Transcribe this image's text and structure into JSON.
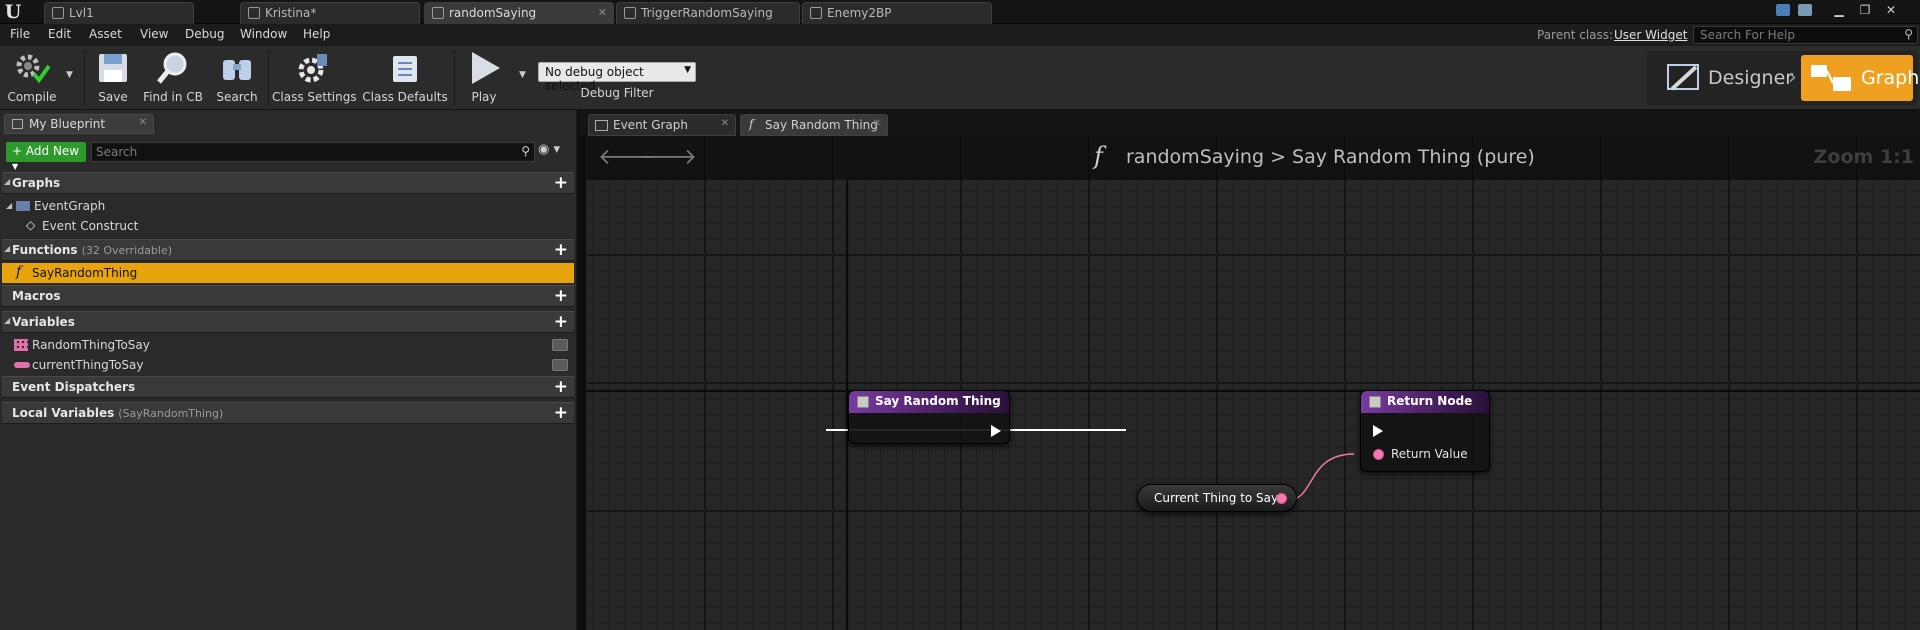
{
  "titlebar": {
    "tabs": [
      {
        "label": "Lvl1"
      },
      {
        "label": "Kristina*"
      },
      {
        "label": "randomSaying"
      },
      {
        "label": "TriggerRandomSaying"
      },
      {
        "label": "Enemy2BP"
      }
    ]
  },
  "menu": {
    "items": [
      "File",
      "Edit",
      "Asset",
      "View",
      "Debug",
      "Window",
      "Help"
    ],
    "parent_class_label": "Parent class:",
    "parent_class_value": "User Widget",
    "help_search_placeholder": "Search For Help"
  },
  "toolbar": {
    "compile": "Compile",
    "save": "Save",
    "find_in_cb": "Find in CB",
    "search": "Search",
    "class_settings": "Class Settings",
    "class_defaults": "Class Defaults",
    "play": "Play",
    "debug_selected": "No debug object selected",
    "debug_filter": "Debug Filter",
    "mode_designer": "Designer",
    "mode_graph": "Graph",
    "accent_color": "#f0a020"
  },
  "left_panel": {
    "tab_label": "My Blueprint",
    "add_new": "Add New",
    "search_placeholder": "Search",
    "sections": {
      "graphs": "Graphs",
      "functions": "Functions",
      "functions_sub": "(32 Overridable)",
      "macros": "Macros",
      "variables": "Variables",
      "event_dispatchers": "Event Dispatchers",
      "local_variables": "Local Variables",
      "local_variables_sub": "(SayRandomThing)"
    },
    "graph_items": [
      "EventGraph",
      "Event Construct"
    ],
    "function_items": [
      "SayRandomThing"
    ],
    "variable_items": [
      "RandomThingToSay",
      "currentThingToSay"
    ]
  },
  "graph": {
    "tabs": [
      "Event Graph",
      "Say Random Thing"
    ],
    "breadcrumb_root": "randomSaying",
    "breadcrumb_sep": ">",
    "breadcrumb_current": "Say Random Thing (pure)",
    "zoom": "Zoom 1:1",
    "nodes": {
      "entry_title": "Say Random Thing",
      "return_title": "Return Node",
      "return_pin": "Return Value",
      "variable_get": "Current Thing to Say"
    },
    "pin_color": "#f07ab0"
  }
}
